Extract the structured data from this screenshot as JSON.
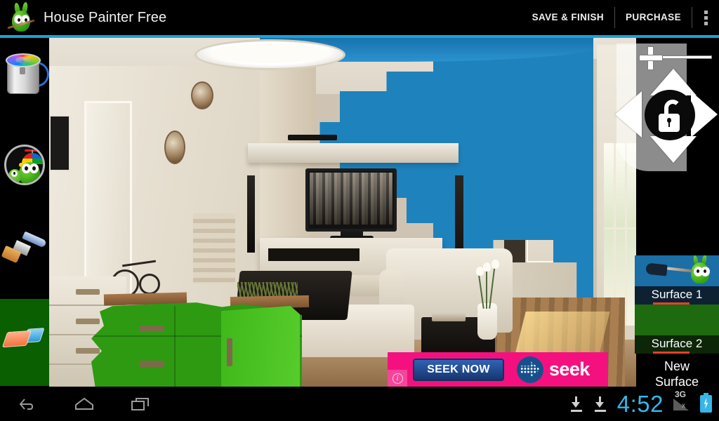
{
  "app": {
    "title": "House Painter Free",
    "icon": "bug-mascot-icon",
    "accent_color": "#1ba1d8"
  },
  "actionbar": {
    "save_label": "SAVE & FINISH",
    "purchase_label": "PURCHASE",
    "overflow_label": "overflow-menu"
  },
  "toolrail": {
    "tools": [
      {
        "name": "paint-bucket",
        "label": "Paint Bucket",
        "selected": false
      },
      {
        "name": "mascot-help",
        "label": "Mascot",
        "selected": false
      },
      {
        "name": "paint-brush",
        "label": "Paint Brush",
        "selected": false
      },
      {
        "name": "eraser",
        "label": "Eraser",
        "selected": true,
        "selected_color": "#0a5f00"
      }
    ]
  },
  "canvas": {
    "description": "living room interior photo",
    "painted_wall_color": "#1e82bd",
    "painted_cabinet_color": "#2d9a12"
  },
  "viewcontrols": {
    "zoom_in_label": "+",
    "zoom_out_label": "-",
    "pan_up": "up",
    "pan_down": "down",
    "pan_left": "left",
    "pan_right": "right",
    "lock_state": "unlocked"
  },
  "surfaces": {
    "items": [
      {
        "name": "surface-1",
        "label": "Surface 1",
        "color": "#1b6ea6",
        "selected": true
      },
      {
        "name": "surface-2",
        "label": "Surface 2",
        "color": "#1d6b0e",
        "selected": false
      }
    ],
    "new_surface_line1": "New",
    "new_surface_line2": "Surface"
  },
  "ad": {
    "button_label": "SEEK NOW",
    "brand": "seek",
    "info_label": "i",
    "background_color": "#f4117f"
  },
  "navbar": {
    "back": "back-icon",
    "home": "home-icon",
    "recents": "recents-icon"
  },
  "statusbar": {
    "download1": "download-icon",
    "download2": "download-icon",
    "clock": "4:52",
    "network": "3G",
    "network_state": "x",
    "battery": "charging",
    "clock_color": "#35b6e8"
  }
}
